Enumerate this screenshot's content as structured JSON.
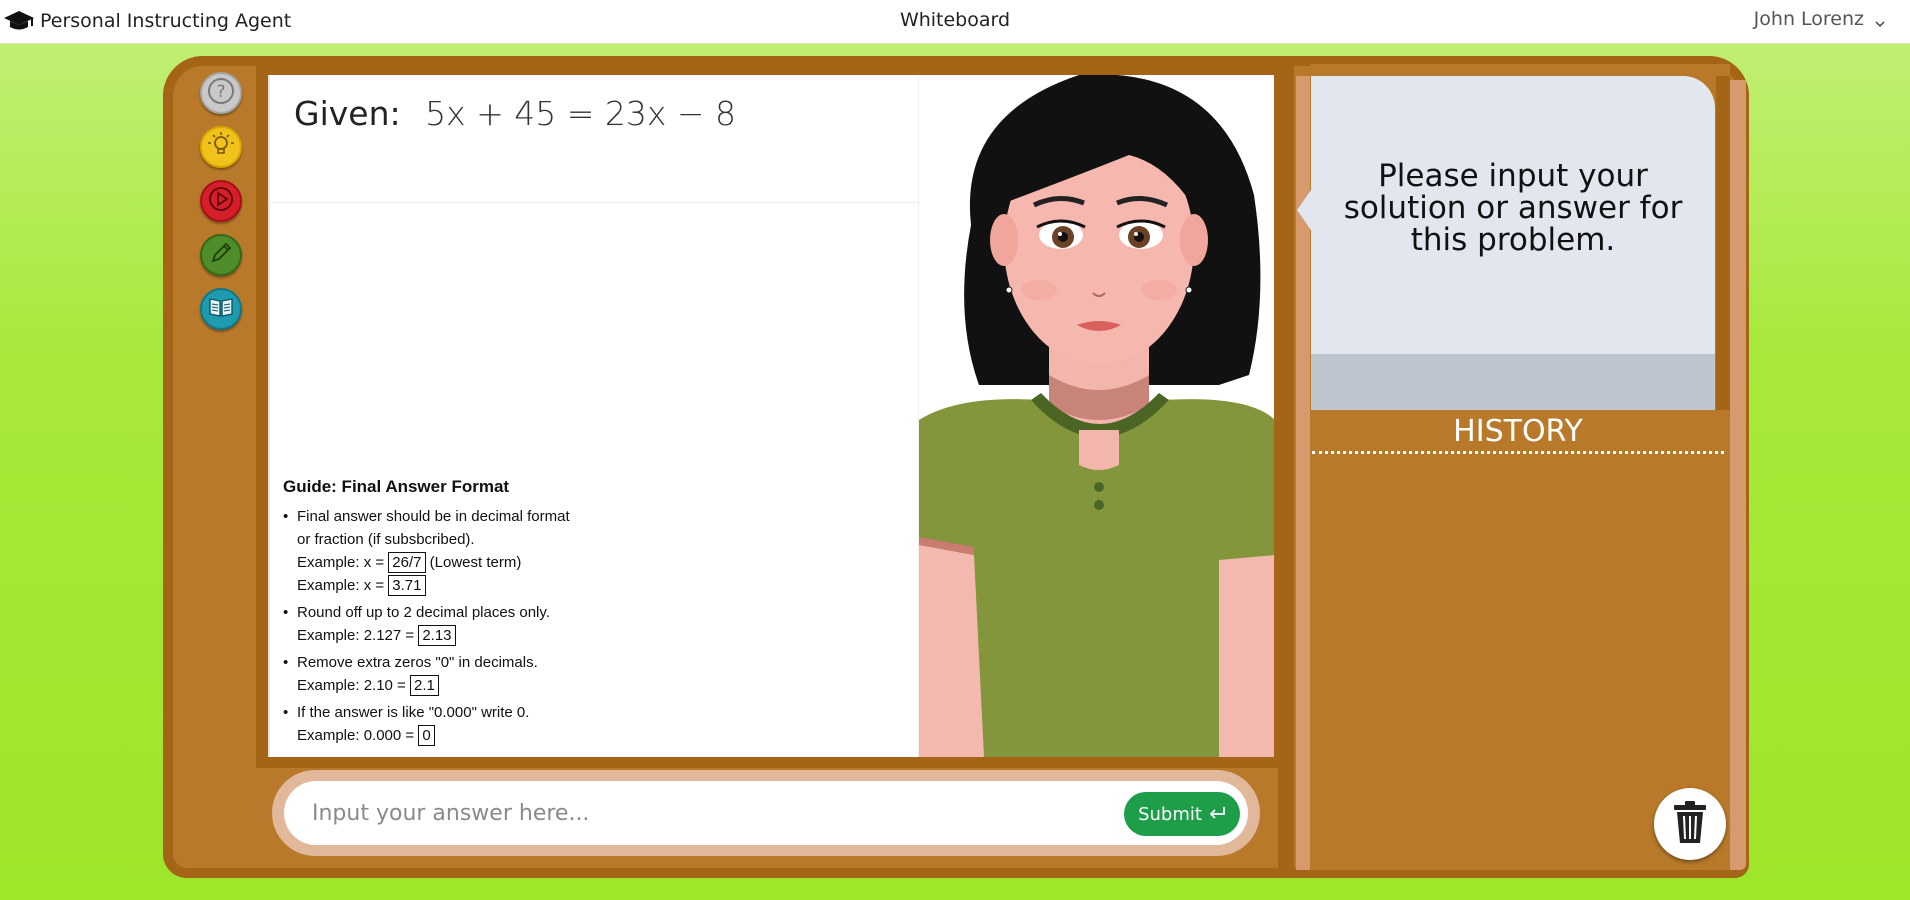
{
  "app": {
    "name": "Personal Instructing Agent",
    "section_title": "Whiteboard",
    "user_name": "John Lorenz"
  },
  "whiteboard": {
    "given_label": "Given:",
    "given_equation": "5x + 45 = 23x − 8"
  },
  "guide": {
    "title": "Guide: Final Answer Format",
    "items": [
      {
        "line1": "Final answer should be in decimal format",
        "line2": "or fraction (if subsbcribed).",
        "ex1_prefix": "Example: x = ",
        "ex1_value": "26/7",
        "ex1_suffix": " (Lowest term)",
        "ex2_prefix": "Example: x = ",
        "ex2_value": "3.71"
      },
      {
        "line1": "Round off up to 2 decimal places only.",
        "ex_prefix": "Example: 2.127 = ",
        "ex_value": "2.13"
      },
      {
        "line1": "Remove extra zeros \"0\" in decimals.",
        "ex_prefix": "Example: 2.10 = ",
        "ex_value": "2.1"
      },
      {
        "line1": "If the answer is like \"0.000\" write 0.",
        "ex_prefix": "Example: 0.000 = ",
        "ex_value": "0"
      }
    ]
  },
  "answer": {
    "placeholder": "Input your answer here...",
    "value": "",
    "submit_label": "Submit"
  },
  "panel": {
    "prompt": "Please input your solution or answer for this problem.",
    "history_label": "HISTORY"
  },
  "tools": [
    {
      "name": "help",
      "icon": "question-icon",
      "color": "#c9c9c9"
    },
    {
      "name": "hint",
      "icon": "lightbulb-icon",
      "color": "#f1c21b"
    },
    {
      "name": "video",
      "icon": "play-icon",
      "color": "#d41f2a"
    },
    {
      "name": "draw",
      "icon": "pencil-icon",
      "color": "#4e8d2a"
    },
    {
      "name": "lesson",
      "icon": "book-icon",
      "color": "#1f9bb0"
    }
  ],
  "colors": {
    "background": "#a8e83a",
    "board_wood": "#b87a2a",
    "submit": "#1f9e4a"
  }
}
